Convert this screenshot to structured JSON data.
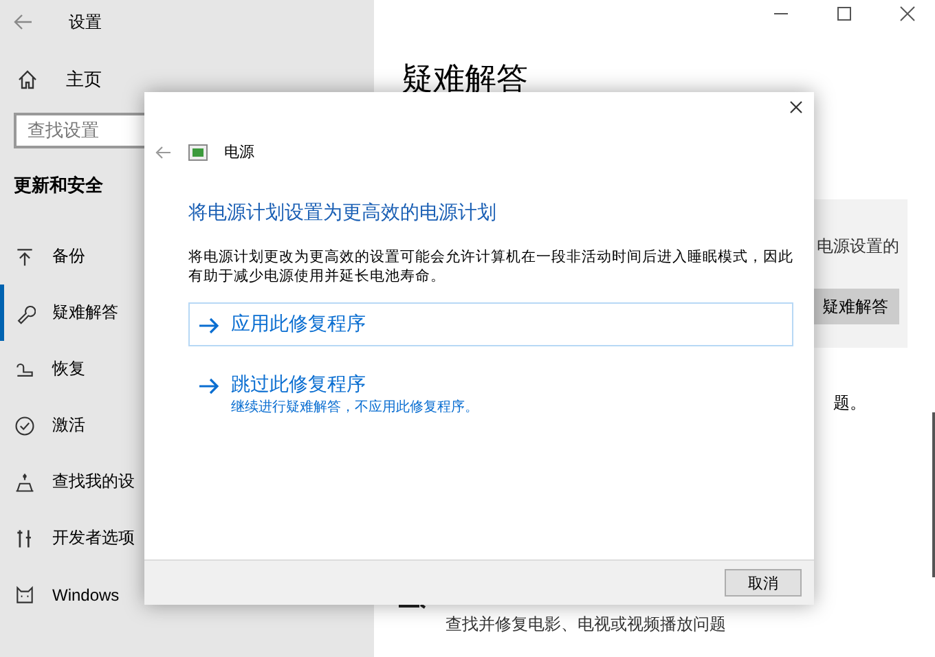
{
  "window": {
    "title": "设置"
  },
  "sidebar": {
    "home": "主页",
    "search": {
      "placeholder": "查找设置"
    },
    "section": "更新和安全",
    "items": [
      {
        "label": "备份",
        "selected": false
      },
      {
        "label": "疑难解答",
        "selected": true
      },
      {
        "label": "恢复",
        "selected": false
      },
      {
        "label": "激活",
        "selected": false
      },
      {
        "label": "查找我的设",
        "selected": false
      },
      {
        "label": "开发者选项",
        "selected": false
      },
      {
        "label": "Windows",
        "selected": false
      }
    ]
  },
  "main": {
    "title": "疑难解答",
    "card_text": "电源设置的",
    "card_button": "疑难解答",
    "note": "题。",
    "item_text": "查找并修复电影、电视或视频播放问题"
  },
  "dialog": {
    "title": "电源",
    "heading": "将电源计划设置为更高效的电源计划",
    "description": "将电源计划更改为更高效的设置可能会允许计算机在一段非活动时间后进入睡眠模式，因此有助于减少电源使用并延长电池寿命。",
    "options": [
      {
        "label": "应用此修复程序",
        "highlighted": true
      },
      {
        "label": "跳过此修复程序",
        "subtext": "继续进行疑难解答，不应用此修复程序。",
        "highlighted": false
      }
    ],
    "buttons": [
      "取消"
    ]
  }
}
